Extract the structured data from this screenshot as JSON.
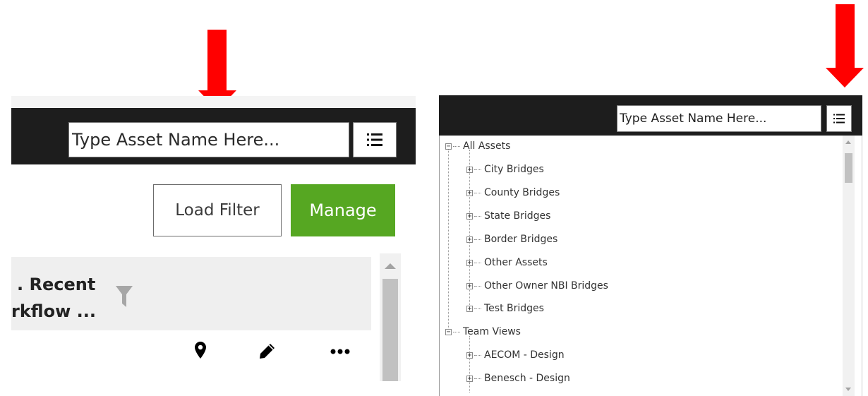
{
  "left_panel": {
    "search": {
      "placeholder": "Type Asset Name Here..."
    },
    "load_filter_label": "Load Filter",
    "manage_label": "Manage",
    "card": {
      "title_line1": "Recent",
      "title_line2": "rkflow ..."
    }
  },
  "right_panel": {
    "search": {
      "placeholder": "Type Asset Name Here..."
    },
    "tree": [
      {
        "label": "All Assets",
        "expander": "−"
      },
      {
        "label": "City Bridges",
        "expander": "+"
      },
      {
        "label": "County Bridges",
        "expander": "+"
      },
      {
        "label": "State Bridges",
        "expander": "+"
      },
      {
        "label": "Border Bridges",
        "expander": "+"
      },
      {
        "label": "Other Assets",
        "expander": "+"
      },
      {
        "label": "Other Owner NBI Bridges",
        "expander": "+"
      },
      {
        "label": "Test Bridges",
        "expander": "+"
      },
      {
        "label": "Team Views",
        "expander": "−"
      },
      {
        "label": "AECOM - Design",
        "expander": "+"
      },
      {
        "label": "Benesch - Design",
        "expander": "+"
      }
    ]
  },
  "colors": {
    "annotation_arrow": "#ff0000",
    "header_bar": "#1d1d1d",
    "manage_button": "#56a722"
  },
  "icons": [
    "list-icon",
    "filter-funnel-icon",
    "map-pin-icon",
    "pencil-icon",
    "more-dots-icon"
  ]
}
